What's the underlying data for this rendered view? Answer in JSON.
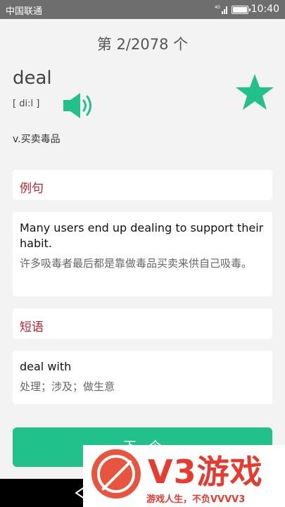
{
  "status": {
    "carrier": "中国联通",
    "network": "4G",
    "time": "10:40"
  },
  "counter": "第 2/2078 个",
  "word": {
    "text": "deal",
    "phonetic": "[ di:l ]",
    "meaning": "v.买卖毒品"
  },
  "example": {
    "header": "例句",
    "en": "Many users end up dealing to support their habit.",
    "cn": "许多吸毒者最后都是靠做毒品买卖来供自己吸毒。"
  },
  "phrase": {
    "header": "短语",
    "en": "deal with",
    "cn": "处理；涉及；做生意"
  },
  "next_button": "下一个",
  "ad": {
    "logo": "V3游戏",
    "slogan": "游戏人生，不负VVVV3"
  },
  "colors": {
    "accent": "#22c08a",
    "header_red": "#c0212f",
    "star": "#22c08a"
  }
}
